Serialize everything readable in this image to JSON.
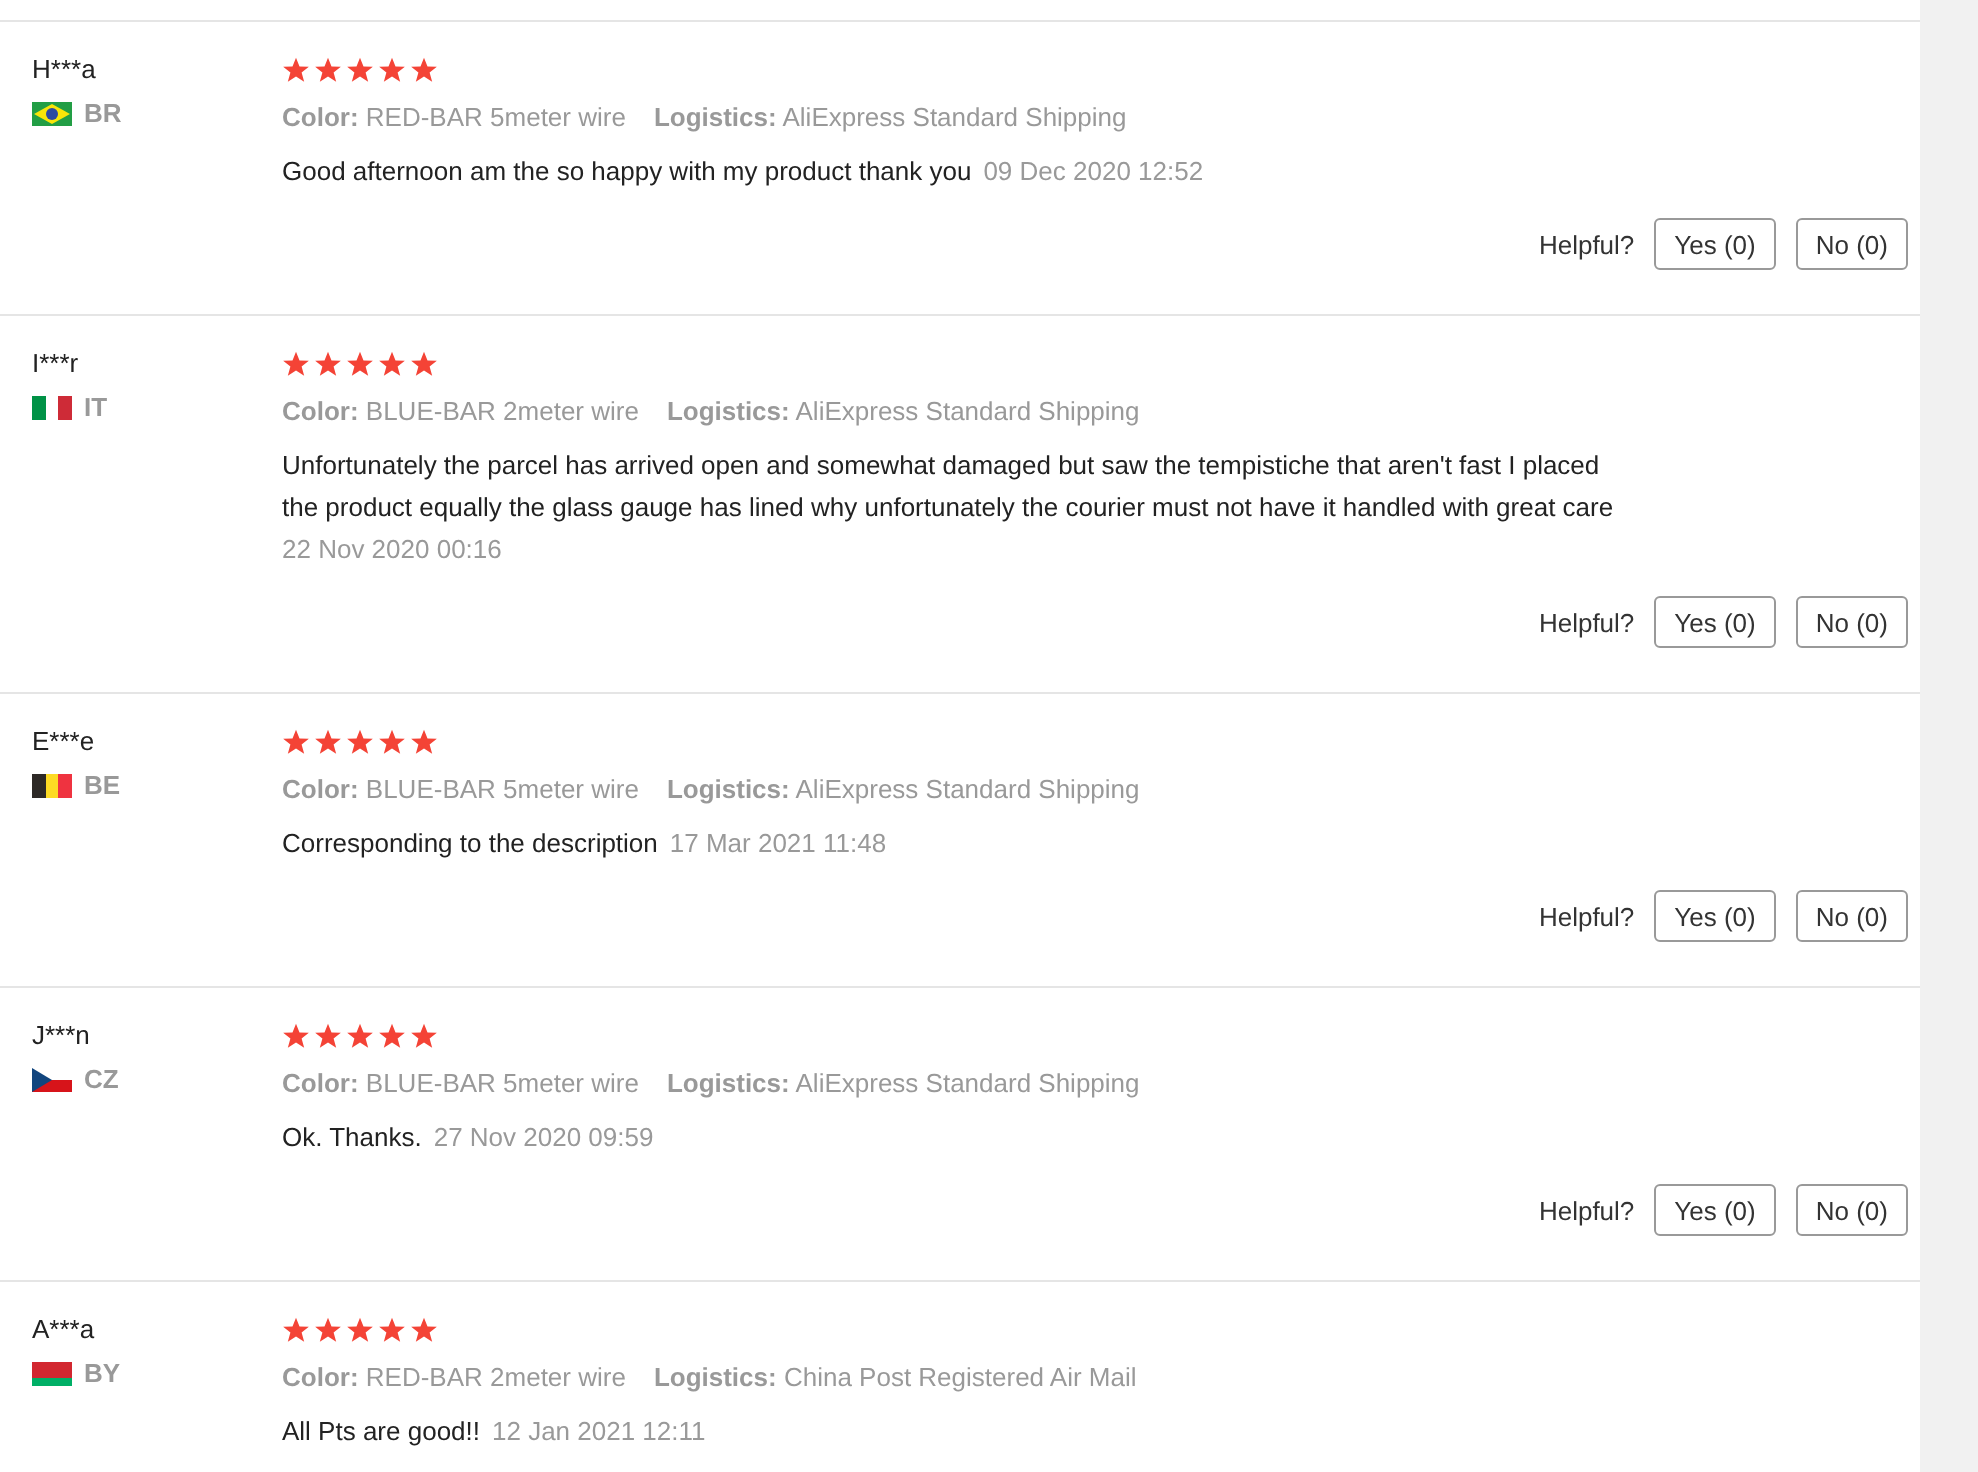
{
  "reviews": [
    {
      "user": "H***a",
      "country": "BR",
      "flag": {
        "kind": "diamond",
        "stripes": [
          {
            "color": "#229e45"
          },
          {
            "color": "#f8e509"
          },
          {
            "color": "#2b49a3"
          }
        ]
      },
      "stars": 5,
      "color_label": "Color:",
      "color_value": "RED-BAR 5meter wire",
      "logistics_label": "Logistics:",
      "logistics_value": "AliExpress Standard Shipping",
      "text": "Good afternoon am the so happy with my product thank you",
      "date": "09 Dec 2020 12:52",
      "helpful": {
        "label": "Helpful?",
        "yes": "Yes (0)",
        "no": "No (0)"
      }
    },
    {
      "user": "I***r",
      "country": "IT",
      "flag": {
        "kind": "vertical",
        "stripes": [
          {
            "color": "#009246"
          },
          {
            "color": "#ffffff"
          },
          {
            "color": "#ce2b37"
          }
        ]
      },
      "stars": 5,
      "color_label": "Color:",
      "color_value": "BLUE-BAR 2meter wire",
      "logistics_label": "Logistics:",
      "logistics_value": "AliExpress Standard Shipping",
      "text": "Unfortunately the parcel has arrived open and somewhat damaged but saw the tempistiche that aren't fast I placed the product equally the glass gauge has lined why unfortunately the courier must not have it handled with great care",
      "date": "22 Nov 2020 00:16",
      "helpful": {
        "label": "Helpful?",
        "yes": "Yes (0)",
        "no": "No (0)"
      }
    },
    {
      "user": "E***e",
      "country": "BE",
      "flag": {
        "kind": "vertical",
        "stripes": [
          {
            "color": "#2d2926"
          },
          {
            "color": "#fdda24"
          },
          {
            "color": "#ef3340"
          }
        ]
      },
      "stars": 5,
      "color_label": "Color:",
      "color_value": "BLUE-BAR 5meter wire",
      "logistics_label": "Logistics:",
      "logistics_value": "AliExpress Standard Shipping",
      "text": "Corresponding to the description",
      "date": "17 Mar 2021 11:48",
      "helpful": {
        "label": "Helpful?",
        "yes": "Yes (0)",
        "no": "No (0)"
      }
    },
    {
      "user": "J***n",
      "country": "CZ",
      "flag": {
        "kind": "chevron",
        "stripes": [
          {
            "color": "#ffffff"
          },
          {
            "color": "#d7141a"
          },
          {
            "color": "#11457e"
          }
        ]
      },
      "stars": 5,
      "color_label": "Color:",
      "color_value": "BLUE-BAR 5meter wire",
      "logistics_label": "Logistics:",
      "logistics_value": "AliExpress Standard Shipping",
      "text": "Ok. Thanks.",
      "date": "27 Nov 2020 09:59",
      "helpful": {
        "label": "Helpful?",
        "yes": "Yes (0)",
        "no": "No (0)"
      }
    },
    {
      "user": "A***a",
      "country": "BY",
      "flag": {
        "kind": "horizontal",
        "stripes": [
          {
            "color": "#d22730"
          },
          {
            "color": "#00af66"
          }
        ]
      },
      "stars": 5,
      "color_label": "Color:",
      "color_value": "RED-BAR 2meter wire",
      "logistics_label": "Logistics:",
      "logistics_value": "China Post Registered Air Mail",
      "text": "All Pts are good!!",
      "date": "12 Jan 2021 12:11"
    }
  ]
}
